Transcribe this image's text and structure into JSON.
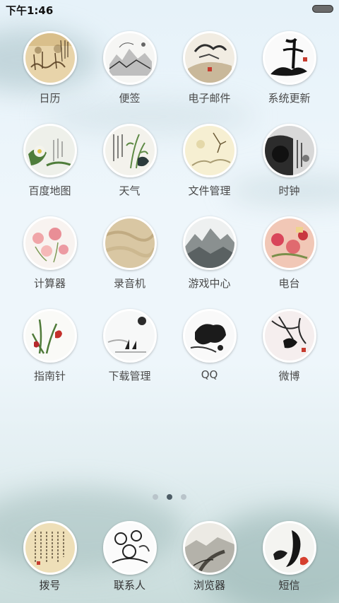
{
  "status_bar": {
    "time": "下午1:46"
  },
  "apps": [
    {
      "label": "日历",
      "icon": "calendar-painting-icon"
    },
    {
      "label": "便签",
      "icon": "notes-painting-icon"
    },
    {
      "label": "电子邮件",
      "icon": "email-painting-icon"
    },
    {
      "label": "系统更新",
      "icon": "system-update-painting-icon"
    },
    {
      "label": "百度地图",
      "icon": "baidu-map-painting-icon"
    },
    {
      "label": "天气",
      "icon": "weather-painting-icon"
    },
    {
      "label": "文件管理",
      "icon": "file-manager-painting-icon"
    },
    {
      "label": "时钟",
      "icon": "clock-painting-icon"
    },
    {
      "label": "计算器",
      "icon": "calculator-painting-icon"
    },
    {
      "label": "录音机",
      "icon": "recorder-painting-icon"
    },
    {
      "label": "游戏中心",
      "icon": "game-center-painting-icon"
    },
    {
      "label": "电台",
      "icon": "radio-painting-icon"
    },
    {
      "label": "指南针",
      "icon": "compass-painting-icon"
    },
    {
      "label": "下载管理",
      "icon": "download-manager-painting-icon"
    },
    {
      "label": "QQ",
      "icon": "qq-painting-icon"
    },
    {
      "label": "微博",
      "icon": "weibo-painting-icon"
    }
  ],
  "page_indicator": {
    "pages": 3,
    "current": 2
  },
  "dock": [
    {
      "label": "拨号",
      "icon": "dialer-painting-icon"
    },
    {
      "label": "联系人",
      "icon": "contacts-painting-icon"
    },
    {
      "label": "浏览器",
      "icon": "browser-painting-icon"
    },
    {
      "label": "短信",
      "icon": "messages-painting-icon"
    }
  ]
}
